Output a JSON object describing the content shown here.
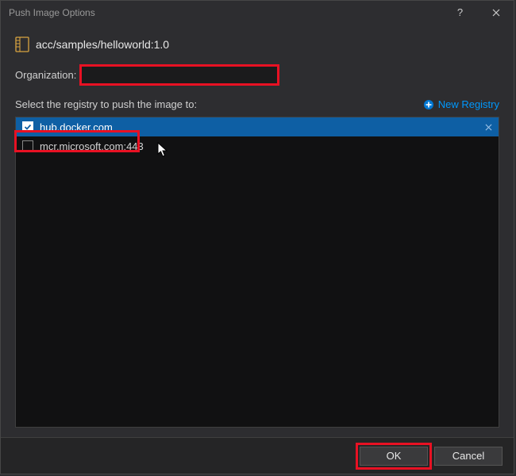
{
  "titlebar": {
    "title": "Push Image Options"
  },
  "image": {
    "name": "acc/samples/helloworld:1.0"
  },
  "org": {
    "label": "Organization:",
    "value": ""
  },
  "registry": {
    "prompt": "Select the registry to push the image to:",
    "new_label": "New Registry",
    "items": [
      {
        "label": "hub.docker.com",
        "checked": true,
        "selected": true
      },
      {
        "label": "mcr.microsoft.com:443",
        "checked": false,
        "selected": false
      }
    ]
  },
  "footer": {
    "ok": "OK",
    "cancel": "Cancel"
  }
}
